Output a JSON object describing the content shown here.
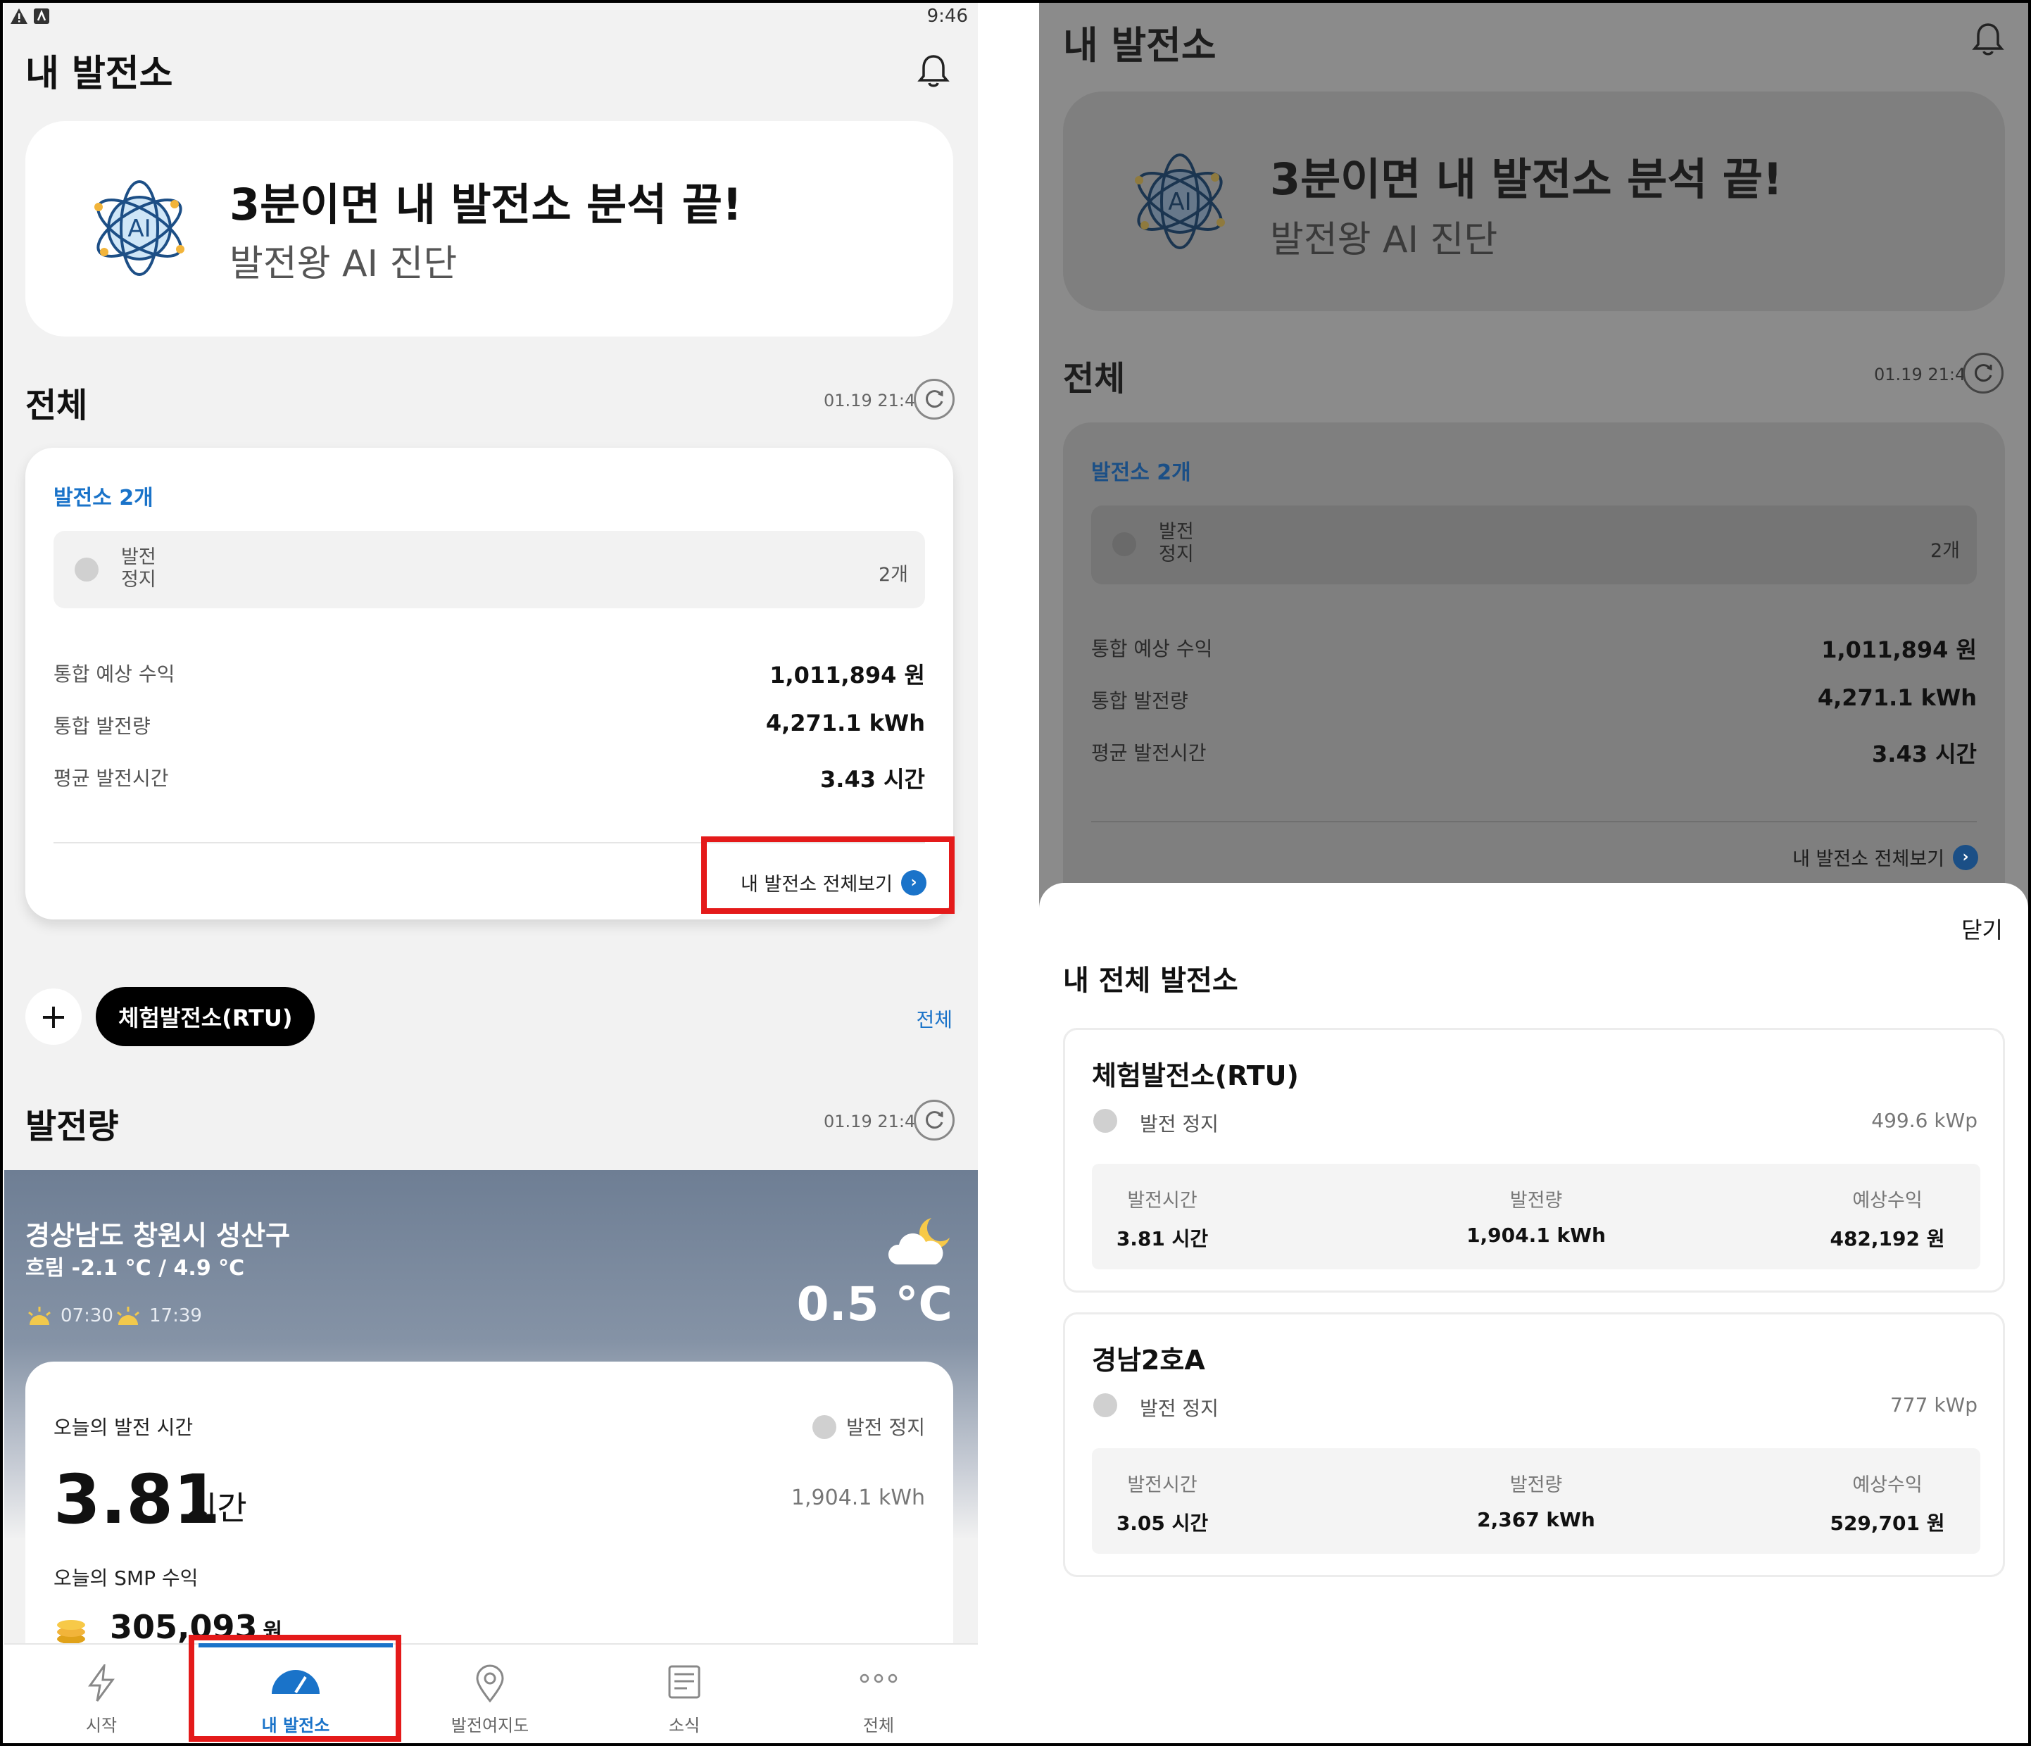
{
  "left": {
    "status_bar": {
      "time": "9:46"
    },
    "page_title": "내 발전소",
    "ai_banner": {
      "title": "3분이면 내 발전소 분석 끝!",
      "subtitle": "발전왕 AI 진단",
      "icon_text": "AI"
    },
    "overall": {
      "heading": "전체",
      "timestamp": "01.19 21:46",
      "plant_count": "발전소 2개",
      "status_label": "발전 정지",
      "status_count": "2개",
      "metrics": [
        {
          "label": "통합 예상 수익",
          "value": "1,011,894 원"
        },
        {
          "label": "통합 발전량",
          "value": "4,271.1 kWh"
        },
        {
          "label": "평균 발전시간",
          "value": "3.43 시간"
        }
      ],
      "view_all": "내 발전소 전체보기"
    },
    "plant_selector": {
      "selected": "체험발전소(RTU)",
      "all_link": "전체"
    },
    "generation": {
      "heading": "발전량",
      "timestamp": "01.19 21:43",
      "weather": {
        "location": "경상남도 창원시 성산구",
        "condition": "흐림 -2.1 °C / 4.9 °C",
        "sunrise": "07:30",
        "sunset": "17:39",
        "temperature": "0.5 °C"
      },
      "today": {
        "hours_label": "오늘의 발전 시간",
        "hours_value": "3.81",
        "hours_unit": "시간",
        "status": "발전 정지",
        "kwh": "1,904.1 kWh",
        "smp_label": "오늘의 SMP 수익",
        "smp_value": "305,093",
        "smp_unit": "원"
      }
    },
    "bottom_nav": [
      {
        "label": "시작",
        "icon": "lightning-icon"
      },
      {
        "label": "내 발전소",
        "icon": "gauge-icon",
        "active": true
      },
      {
        "label": "발전여지도",
        "icon": "map-pin-icon"
      },
      {
        "label": "소식",
        "icon": "news-icon"
      },
      {
        "label": "전체",
        "icon": "more-icon"
      }
    ]
  },
  "right": {
    "page_title": "내 발전소",
    "ai_banner": {
      "title": "3분이면 내 발전소 분석 끝!",
      "subtitle": "발전왕 AI 진단",
      "icon_text": "AI"
    },
    "overall": {
      "heading": "전체",
      "timestamp": "01.19 21:46",
      "plant_count": "발전소 2개",
      "status_label": "발전 정지",
      "status_count": "2개",
      "metrics": [
        {
          "label": "통합 예상 수익",
          "value": "1,011,894 원"
        },
        {
          "label": "통합 발전량",
          "value": "4,271.1 kWh"
        },
        {
          "label": "평균 발전시간",
          "value": "3.43 시간"
        }
      ],
      "view_all": "내 발전소 전체보기"
    },
    "sheet": {
      "close": "닫기",
      "title": "내 전체 발전소",
      "plants": [
        {
          "name": "체험발전소(RTU)",
          "status": "발전 정지",
          "capacity": "499.6 kWp",
          "stats": [
            {
              "label": "발전시간",
              "value": "3.81 시간"
            },
            {
              "label": "발전량",
              "value": "1,904.1 kWh"
            },
            {
              "label": "예상수익",
              "value": "482,192 원"
            }
          ]
        },
        {
          "name": "경남2호A",
          "status": "발전 정지",
          "capacity": "777 kWp",
          "stats": [
            {
              "label": "발전시간",
              "value": "3.05 시간"
            },
            {
              "label": "발전량",
              "value": "2,367 kWh"
            },
            {
              "label": "예상수익",
              "value": "529,701 원"
            }
          ]
        }
      ]
    }
  },
  "colors": {
    "accent": "#1a73c9",
    "highlight": "#e41a1a",
    "overlay": "#8b8b8b"
  }
}
